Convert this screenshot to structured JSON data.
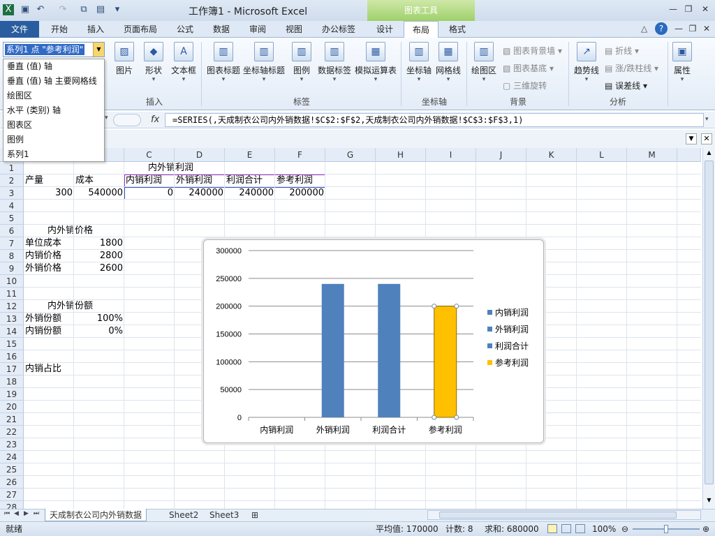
{
  "window": {
    "title": "工作簿1 - Microsoft Excel",
    "context_tab_group": "图表工具"
  },
  "tabs": [
    {
      "label": "文件"
    },
    {
      "label": "开始"
    },
    {
      "label": "插入"
    },
    {
      "label": "页面布局"
    },
    {
      "label": "公式"
    },
    {
      "label": "数据"
    },
    {
      "label": "审阅"
    },
    {
      "label": "视图"
    },
    {
      "label": "办公标签"
    },
    {
      "label": "设计"
    },
    {
      "label": "布局"
    },
    {
      "label": "格式"
    }
  ],
  "ribbon": {
    "insert": {
      "picture": "图片",
      "shape": "形状",
      "textbox": "文本框",
      "group": "插入"
    },
    "labels": {
      "chart_title": "图表标题",
      "axis_title": "坐标轴标题",
      "legend": "图例",
      "data_labels": "数据标签",
      "data_table": "模拟运算表",
      "group": "标签"
    },
    "axes": {
      "axes": "坐标轴",
      "gridlines": "网格线",
      "group": "坐标轴"
    },
    "background": {
      "plot_area": "绘图区",
      "chart_wall": "图表背景墙",
      "chart_floor": "图表基底",
      "rotation": "三维旋转",
      "group": "背景"
    },
    "analysis": {
      "trendline": "趋势线",
      "lines": "折线",
      "updown": "涨/跌柱线",
      "errorbars": "误差线",
      "group": "分析"
    },
    "properties": {
      "label": "属性"
    }
  },
  "element_selector": {
    "value": "系列1 点 \"参考利润\"",
    "options": [
      "垂直 (值) 轴",
      "垂直 (值) 轴 主要网格线",
      "绘图区",
      "水平 (类别) 轴",
      "图表区",
      "图例",
      "系列1"
    ]
  },
  "formula_bar": {
    "fx": "fx",
    "formula": "=SERIES(,天成制衣公司内外销数据!$C$2:$F$2,天成制衣公司内外销数据!$C$3:$F$3,1)"
  },
  "columns": [
    "C",
    "D",
    "E",
    "F",
    "G",
    "H",
    "I",
    "J",
    "K",
    "L",
    "M"
  ],
  "rows": [
    "1",
    "2",
    "3",
    "4",
    "5",
    "6",
    "7",
    "8",
    "9",
    "10",
    "11",
    "12",
    "13",
    "14",
    "15",
    "16",
    "17",
    "18",
    "19",
    "20",
    "21",
    "22",
    "23",
    "24",
    "25",
    "26",
    "27",
    "28"
  ],
  "cells": {
    "c1": "内外销利润",
    "a2": "产量",
    "b2": "成本",
    "c2": "内销利润",
    "d2": "外销利润",
    "e2": "利润合计",
    "f2": "参考利润",
    "a3": "300",
    "b3": "540000",
    "c3": "0",
    "d3": "240000",
    "e3": "240000",
    "f3": "200000",
    "a6": "内外销价格",
    "a7": "单位成本",
    "b7": "1800",
    "a8": "内销价格",
    "b8": "2800",
    "a9": "外销价格",
    "b9": "2600",
    "a12": "内外销份额",
    "a13": "外销份额",
    "b13": "100%",
    "a14": "内销份额",
    "b14": "0%",
    "a17": "内销占比"
  },
  "chart_data": {
    "type": "bar",
    "categories": [
      "内销利润",
      "外销利润",
      "利润合计",
      "参考利润"
    ],
    "values": [
      0,
      240000,
      240000,
      200000
    ],
    "ylim": [
      0,
      300000
    ],
    "yticks": [
      "300000",
      "250000",
      "200000",
      "150000",
      "100000",
      "50000",
      "0"
    ],
    "legend": [
      "内销利润",
      "外销利润",
      "利润合计",
      "参考利润"
    ],
    "legend_position": "right",
    "grid": true,
    "bar_color": "#4f81bd",
    "highlight_color": "#ffc000",
    "highlight_index": 3
  },
  "sheets": [
    {
      "label": "天成制衣公司内外销数据"
    },
    {
      "label": "Sheet2"
    },
    {
      "label": "Sheet3"
    }
  ],
  "status": {
    "ready": "就绪",
    "average": "平均值: 170000",
    "count": "计数: 8",
    "sum": "求和: 680000",
    "zoom": "100%"
  }
}
